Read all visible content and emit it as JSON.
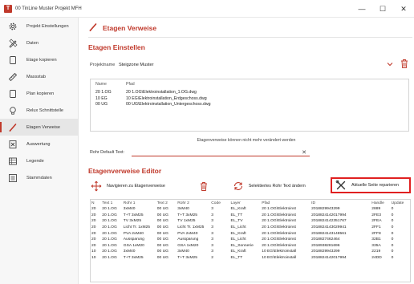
{
  "window": {
    "title": "00 TinLine Muster Projekt MFH",
    "logo": "T",
    "minimize": "—",
    "maximize": "☐",
    "close": "✕"
  },
  "sidebar": {
    "items": [
      {
        "label": "Projekt Einstellungen",
        "icon": "gear-icon"
      },
      {
        "label": "Daten",
        "icon": "pencil-ruler-icon"
      },
      {
        "label": "Etage kopieren",
        "icon": "document-icon"
      },
      {
        "label": "Massstab",
        "icon": "ruler-icon"
      },
      {
        "label": "Plan kopieren",
        "icon": "document-icon"
      },
      {
        "label": "Relux Schnittstelle",
        "icon": "lightbulb-icon"
      },
      {
        "label": "Etagen Verweise",
        "icon": "pen-icon",
        "active": true
      },
      {
        "label": "Auswertung",
        "icon": "excel-icon"
      },
      {
        "label": "Legende",
        "icon": "legend-icon"
      },
      {
        "label": "Stammdaten",
        "icon": "list-icon"
      }
    ]
  },
  "header": {
    "title": "Etagen Verweise"
  },
  "etagen_einstellen": {
    "title": "Etagen Einstellen",
    "project_label": "Projektname",
    "project_value": "Steigzone Muster",
    "list_headers": [
      "Name",
      "Pfad"
    ],
    "rows": [
      [
        "20 1.OG",
        "20 1.OG\\Elektroinstallation_1.OG.dwg"
      ],
      [
        "10 EG",
        "10 EG\\Elektroinstallation_Erdgeschoss.dwg"
      ],
      [
        "00 UG",
        "00 UG\\Elektroinstallation_Untergeschoss.dwg"
      ]
    ],
    "info_message": "Etagenverweise können nicht mehr verändert werden",
    "rohr_label": "Rohr Default Text:",
    "rohr_value": "",
    "clear_symbol": "✕"
  },
  "editor": {
    "title": "Etagenverweise Editor",
    "navigate_label": "Navigieren zu Etagenverweise",
    "change_label": "Selektiertes Rohr Text ändern",
    "repair_label": "Aktuelle Seite reparieren",
    "columns": [
      "N",
      "Text 1",
      "Rohr 1",
      "Text 2",
      "Rohr 2",
      "Code",
      "Layer",
      "Pfad",
      "ID",
      "Handle",
      "Update"
    ],
    "rows": [
      [
        "20",
        "20 1.OG",
        "3xM40",
        "00 UG",
        "3xM40",
        "3",
        "EL_Kraft",
        "20 1.OG\\Elektroinst",
        "2018829943299",
        "2889",
        "0"
      ],
      [
        "20",
        "20 1.OG",
        "T+T 3xM25",
        "00 UG",
        "T+T 3xM25",
        "3",
        "EL_TT",
        "20 1.OG\\Elektroinst",
        "2018824142017994",
        "2FE3",
        "0"
      ],
      [
        "20",
        "20 1.OG",
        "TV 3xM25",
        "00 UG",
        "TV 1xM25",
        "3",
        "EL_TV",
        "20 1.OG\\Elektroinst",
        "2018824142351767",
        "2FEA",
        "0"
      ],
      [
        "20",
        "20 1.OG",
        "Licht Tr. 1xM25",
        "00 UG",
        "Licht Tr. 1xM25",
        "3",
        "EL_Licht",
        "20 1.OG\\Elektroinst",
        "2018824143029941",
        "2FF1",
        "0"
      ],
      [
        "20",
        "20 1.OG",
        "PVA 2xM40",
        "00 UG",
        "PVA 2xM40",
        "3",
        "EL_Kraft",
        "20 1.OG\\Elektroinst",
        "2018824143148561",
        "2FF8",
        "0"
      ],
      [
        "20",
        "20 1.OG",
        "Aussparung",
        "00 UG",
        "Aussparung",
        "3",
        "EL_Licht",
        "20 1.OG\\Elektroinst",
        "2018827462464",
        "32B1",
        "0"
      ],
      [
        "20",
        "20 1.OG",
        "GSA 1xM20",
        "00 UG",
        "GSA 1xM20",
        "3",
        "EL_Sonnerie",
        "20 1.OG\\Elektroinst",
        "2018938281696",
        "335A",
        "0"
      ],
      [
        "10",
        "20 1.OG",
        "3xM40",
        "00 UG",
        "3xM40",
        "3",
        "EL_Kraft",
        "10 EG\\Elektroinstall",
        "2018829943299",
        "2219",
        "0"
      ],
      [
        "10",
        "20 1.OG",
        "T+T 3xM25",
        "00 UG",
        "T+T 3xM25",
        "2",
        "EL_TT",
        "10 EG\\Elektroinstall",
        "2018824142017994",
        "24DD",
        "0"
      ]
    ]
  },
  "colors": {
    "accent": "#c0392b",
    "highlight": "#e02020"
  }
}
